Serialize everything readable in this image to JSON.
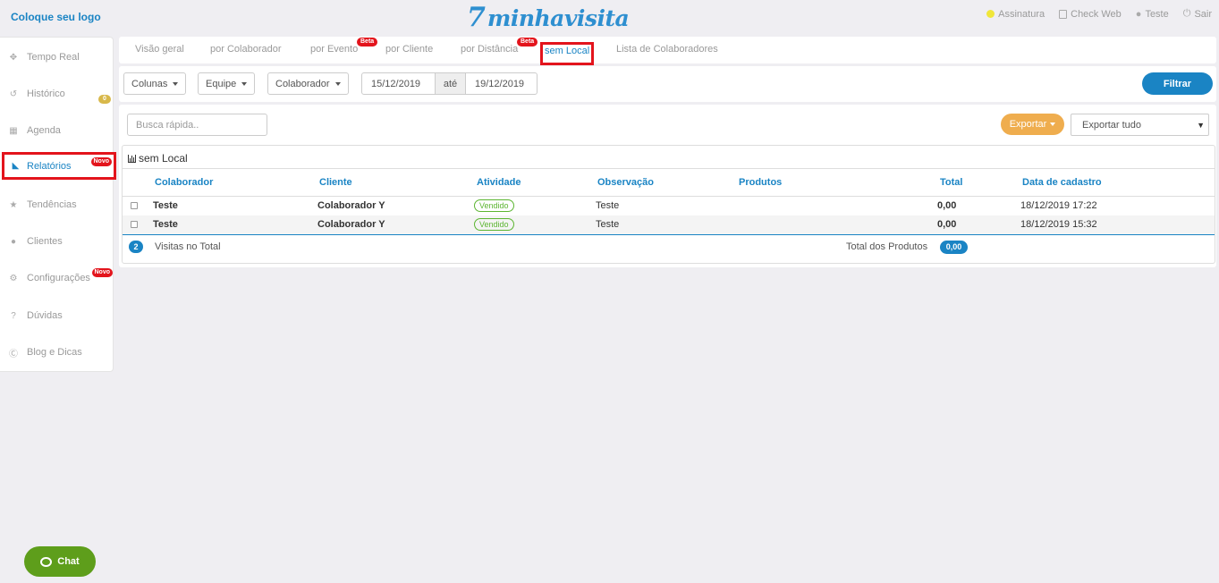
{
  "header": {
    "logo_placeholder": "Coloque seu logo",
    "brand_mark": "7",
    "brand_word": "minhavisita",
    "links": [
      {
        "label": "Assinatura",
        "icon": "lightbulb-icon"
      },
      {
        "label": "Check Web",
        "icon": "mobile-icon"
      },
      {
        "label": "Teste",
        "icon": "user-icon"
      },
      {
        "label": "Sair",
        "icon": "power-icon"
      }
    ]
  },
  "sidebar": {
    "items": [
      {
        "label": "Tempo Real",
        "icon": "crosshair-icon"
      },
      {
        "label": "Histórico",
        "icon": "history-icon",
        "badge": "0"
      },
      {
        "label": "Agenda",
        "icon": "calendar-icon"
      },
      {
        "label": "Relatórios",
        "icon": "area-chart-icon",
        "badge": "Novo"
      },
      {
        "label": "Tendências",
        "icon": "trophy-icon"
      },
      {
        "label": "Clientes",
        "icon": "users-icon"
      },
      {
        "label": "Configurações",
        "icon": "gears-icon",
        "badge": "Novo"
      },
      {
        "label": "Dúvidas",
        "icon": "question-icon"
      },
      {
        "label": "Blog e Dicas",
        "icon": "wordpress-icon"
      }
    ]
  },
  "tabs": [
    {
      "label": "Visão geral"
    },
    {
      "label": "por Colaborador"
    },
    {
      "label": "por Evento",
      "badge": "Beta"
    },
    {
      "label": "por Cliente"
    },
    {
      "label": "por Distância",
      "badge": "Beta"
    },
    {
      "label": "sem Local",
      "active": true
    },
    {
      "label": "Lista de Colaboradores"
    }
  ],
  "filters": {
    "colunas": "Colunas",
    "equipe": "Equipe",
    "colaborador": "Colaborador",
    "date_from": "15/12/2019",
    "ate": "até",
    "date_to": "19/12/2019",
    "filtrar": "Filtrar"
  },
  "toolbar": {
    "search_placeholder": "Busca rápida..",
    "exportar": "Exportar",
    "exportar_tudo": "Exportar tudo"
  },
  "report": {
    "title": "sem Local",
    "columns": [
      "Colaborador",
      "Cliente",
      "Atividade",
      "Observação",
      "Produtos",
      "Total",
      "Data de cadastro"
    ],
    "rows": [
      {
        "colaborador": "Teste",
        "cliente": "Colaborador Y",
        "atividade": "Vendido",
        "observacao": "Teste",
        "produtos": "",
        "total": "0,00",
        "data": "18/12/2019 17:22"
      },
      {
        "colaborador": "Teste",
        "cliente": "Colaborador Y",
        "atividade": "Vendido",
        "observacao": "Teste",
        "produtos": "",
        "total": "0,00",
        "data": "18/12/2019 15:32"
      }
    ],
    "footer": {
      "count": "2",
      "visits_label": "Visitas no Total",
      "products_label": "Total dos Produtos",
      "products_total": "0,00"
    }
  },
  "chat": {
    "label": "Chat"
  },
  "colors": {
    "accent": "#1a84c4",
    "highlight": "#e3141c",
    "export": "#efad4e",
    "success": "#5cb531",
    "chat": "#5e9e1b"
  }
}
